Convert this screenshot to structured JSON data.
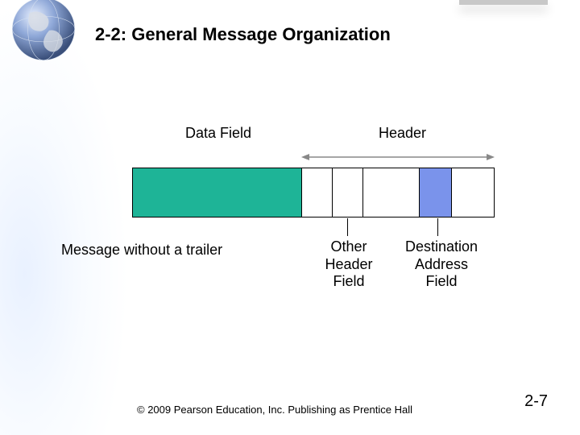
{
  "title": "2-2: General Message Organization",
  "labels": {
    "data_field": "Data Field",
    "header": "Header",
    "message_no_trailer": "Message without a trailer",
    "other_header_field": "Other\nHeader\nField",
    "destination_address_field": "Destination\nAddress\nField"
  },
  "footer": {
    "copyright": "© 2009 Pearson Education, Inc.  Publishing as Prentice Hall",
    "page": "2-7"
  },
  "colors": {
    "data_segment": "#1eb497",
    "dest_segment": "#7a93eb"
  }
}
